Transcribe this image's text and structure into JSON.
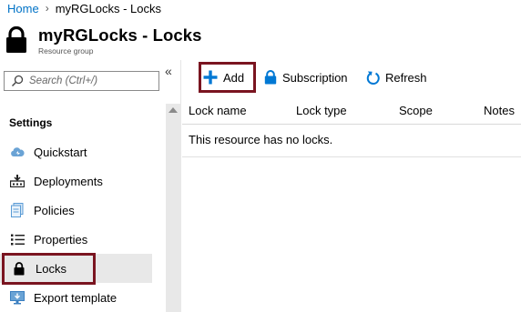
{
  "breadcrumb": {
    "home": "Home",
    "separator": "›",
    "current": "myRGLocks - Locks"
  },
  "header": {
    "title": "myRGLocks - Locks",
    "subtitle": "Resource group",
    "icon": "lock-icon"
  },
  "sidebar": {
    "search_placeholder": "Search (Ctrl+/)",
    "collapse_glyph": "«",
    "section": "Settings",
    "items": [
      {
        "label": "Quickstart",
        "icon": "cloud-icon"
      },
      {
        "label": "Deployments",
        "icon": "deployments-icon"
      },
      {
        "label": "Policies",
        "icon": "policies-icon"
      },
      {
        "label": "Properties",
        "icon": "properties-icon"
      },
      {
        "label": "Locks",
        "icon": "lock-icon",
        "active": true
      },
      {
        "label": "Export template",
        "icon": "export-template-icon"
      }
    ]
  },
  "toolbar": {
    "add_label": "Add",
    "subscription_label": "Subscription",
    "refresh_label": "Refresh"
  },
  "table": {
    "columns": [
      "Lock name",
      "Lock type",
      "Scope",
      "Notes"
    ],
    "empty_message": "This resource has no locks."
  },
  "colors": {
    "highlight": "#7a1420",
    "link": "#0072c6",
    "accent_icon": "#0078d4",
    "active_bg": "#e8e8e8"
  }
}
